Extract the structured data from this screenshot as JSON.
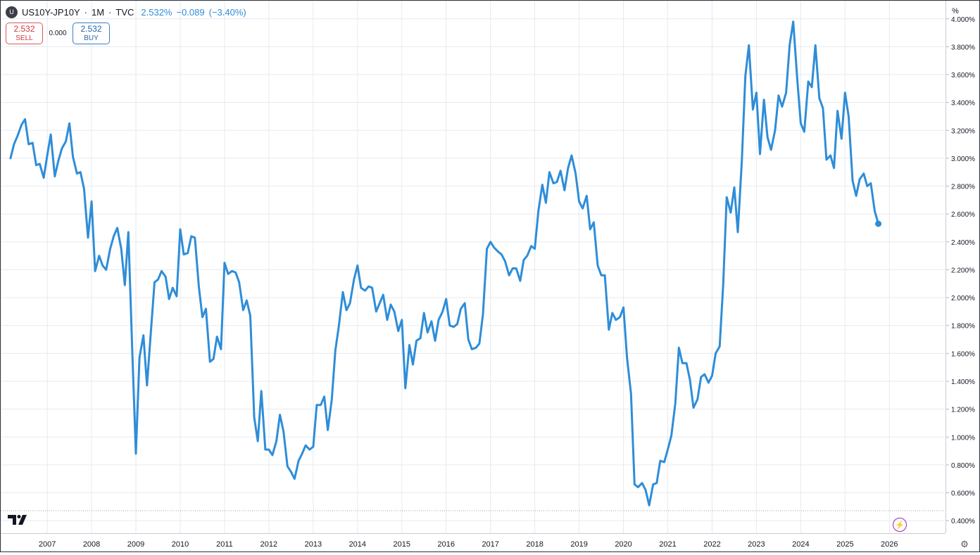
{
  "header": {
    "symbol_icon": "U",
    "symbol": "US10Y-JP10Y",
    "interval": "1M",
    "source": "TVC",
    "sep": "·",
    "last": "2.532%",
    "change": "−0.089",
    "change_pct": "(−3.40%)"
  },
  "trade": {
    "sell_price": "2.532",
    "sell_label": "SELL",
    "spread": "0.000",
    "buy_price": "2.532",
    "buy_label": "BUY"
  },
  "price_axis": {
    "unit": "%"
  },
  "icons": {
    "logo": "tradingview-logo",
    "bolt": "lightning-icon",
    "settings": "gear-icon"
  },
  "colors": {
    "line": "#2e8dd8",
    "grid": "#e6eaf0",
    "sell": "#d0393d",
    "buy": "#2962a8",
    "accent": "#9c27b0"
  },
  "chart_data": {
    "type": "line",
    "title": "",
    "xlabel": "",
    "ylabel": "",
    "xlim": [
      2005.95,
      2027.25
    ],
    "ylim": [
      0.31,
      4.13
    ],
    "grid": true,
    "x_ticks": [
      "2007",
      "2008",
      "2009",
      "2010",
      "2011",
      "2012",
      "2013",
      "2014",
      "2015",
      "2016",
      "2017",
      "2018",
      "2019",
      "2020",
      "2021",
      "2022",
      "2023",
      "2024",
      "2025",
      "2026"
    ],
    "y_ticks": [
      "0.400%",
      "0.600%",
      "0.800%",
      "1.000%",
      "1.200%",
      "1.400%",
      "1.600%",
      "1.800%",
      "2.000%",
      "2.200%",
      "2.400%",
      "2.600%",
      "2.800%",
      "3.000%",
      "3.200%",
      "3.400%",
      "3.600%",
      "3.800%",
      "4.000%"
    ],
    "series": [
      {
        "values": [
          [
            2006.17,
            3.0
          ],
          [
            2006.25,
            3.1
          ],
          [
            2006.33,
            3.16
          ],
          [
            2006.42,
            3.24
          ],
          [
            2006.5,
            3.28
          ],
          [
            2006.58,
            3.1
          ],
          [
            2006.67,
            3.11
          ],
          [
            2006.75,
            2.95
          ],
          [
            2006.83,
            2.96
          ],
          [
            2006.92,
            2.86
          ],
          [
            2007.0,
            3.02
          ],
          [
            2007.08,
            3.17
          ],
          [
            2007.17,
            2.87
          ],
          [
            2007.25,
            2.98
          ],
          [
            2007.33,
            3.07
          ],
          [
            2007.42,
            3.12
          ],
          [
            2007.5,
            3.25
          ],
          [
            2007.58,
            3.01
          ],
          [
            2007.67,
            2.89
          ],
          [
            2007.75,
            2.9
          ],
          [
            2007.83,
            2.78
          ],
          [
            2007.92,
            2.43
          ],
          [
            2008.0,
            2.69
          ],
          [
            2008.08,
            2.19
          ],
          [
            2008.17,
            2.3
          ],
          [
            2008.25,
            2.23
          ],
          [
            2008.33,
            2.2
          ],
          [
            2008.42,
            2.35
          ],
          [
            2008.5,
            2.44
          ],
          [
            2008.58,
            2.5
          ],
          [
            2008.67,
            2.35
          ],
          [
            2008.75,
            2.09
          ],
          [
            2008.83,
            2.47
          ],
          [
            2008.92,
            1.6
          ],
          [
            2009.0,
            0.88
          ],
          [
            2009.08,
            1.57
          ],
          [
            2009.17,
            1.73
          ],
          [
            2009.25,
            1.37
          ],
          [
            2009.33,
            1.72
          ],
          [
            2009.42,
            2.11
          ],
          [
            2009.5,
            2.13
          ],
          [
            2009.58,
            2.19
          ],
          [
            2009.67,
            2.15
          ],
          [
            2009.75,
            1.99
          ],
          [
            2009.83,
            2.07
          ],
          [
            2009.92,
            2.01
          ],
          [
            2010.0,
            2.49
          ],
          [
            2010.08,
            2.31
          ],
          [
            2010.17,
            2.32
          ],
          [
            2010.25,
            2.44
          ],
          [
            2010.33,
            2.43
          ],
          [
            2010.42,
            2.08
          ],
          [
            2010.5,
            1.86
          ],
          [
            2010.58,
            1.92
          ],
          [
            2010.67,
            1.54
          ],
          [
            2010.75,
            1.56
          ],
          [
            2010.83,
            1.72
          ],
          [
            2010.92,
            1.63
          ],
          [
            2011.0,
            2.25
          ],
          [
            2011.08,
            2.17
          ],
          [
            2011.17,
            2.19
          ],
          [
            2011.25,
            2.18
          ],
          [
            2011.33,
            2.11
          ],
          [
            2011.42,
            1.91
          ],
          [
            2011.5,
            1.98
          ],
          [
            2011.58,
            1.87
          ],
          [
            2011.67,
            1.14
          ],
          [
            2011.75,
            0.97
          ],
          [
            2011.83,
            1.33
          ],
          [
            2011.92,
            0.91
          ],
          [
            2012.0,
            0.91
          ],
          [
            2012.08,
            0.87
          ],
          [
            2012.17,
            0.97
          ],
          [
            2012.25,
            1.16
          ],
          [
            2012.33,
            1.04
          ],
          [
            2012.42,
            0.79
          ],
          [
            2012.5,
            0.75
          ],
          [
            2012.58,
            0.7
          ],
          [
            2012.67,
            0.83
          ],
          [
            2012.75,
            0.88
          ],
          [
            2012.83,
            0.94
          ],
          [
            2012.92,
            0.91
          ],
          [
            2013.0,
            0.93
          ],
          [
            2013.08,
            1.23
          ],
          [
            2013.17,
            1.23
          ],
          [
            2013.25,
            1.29
          ],
          [
            2013.33,
            1.05
          ],
          [
            2013.42,
            1.27
          ],
          [
            2013.5,
            1.62
          ],
          [
            2013.58,
            1.8
          ],
          [
            2013.67,
            2.04
          ],
          [
            2013.75,
            1.91
          ],
          [
            2013.83,
            1.96
          ],
          [
            2013.92,
            2.13
          ],
          [
            2014.0,
            2.23
          ],
          [
            2014.08,
            2.07
          ],
          [
            2014.17,
            2.05
          ],
          [
            2014.25,
            2.08
          ],
          [
            2014.33,
            2.07
          ],
          [
            2014.42,
            1.9
          ],
          [
            2014.5,
            1.96
          ],
          [
            2014.58,
            2.02
          ],
          [
            2014.67,
            1.84
          ],
          [
            2014.75,
            1.95
          ],
          [
            2014.83,
            1.9
          ],
          [
            2014.92,
            1.76
          ],
          [
            2015.0,
            1.84
          ],
          [
            2015.08,
            1.35
          ],
          [
            2015.17,
            1.66
          ],
          [
            2015.25,
            1.52
          ],
          [
            2015.33,
            1.69
          ],
          [
            2015.42,
            1.71
          ],
          [
            2015.5,
            1.89
          ],
          [
            2015.58,
            1.75
          ],
          [
            2015.67,
            1.83
          ],
          [
            2015.75,
            1.69
          ],
          [
            2015.83,
            1.84
          ],
          [
            2015.92,
            1.9
          ],
          [
            2016.0,
            1.99
          ],
          [
            2016.08,
            1.8
          ],
          [
            2016.17,
            1.79
          ],
          [
            2016.25,
            1.81
          ],
          [
            2016.33,
            1.92
          ],
          [
            2016.42,
            1.96
          ],
          [
            2016.5,
            1.7
          ],
          [
            2016.58,
            1.63
          ],
          [
            2016.67,
            1.64
          ],
          [
            2016.75,
            1.67
          ],
          [
            2016.83,
            1.88
          ],
          [
            2016.92,
            2.35
          ],
          [
            2017.0,
            2.4
          ],
          [
            2017.08,
            2.36
          ],
          [
            2017.17,
            2.33
          ],
          [
            2017.25,
            2.31
          ],
          [
            2017.33,
            2.26
          ],
          [
            2017.42,
            2.16
          ],
          [
            2017.5,
            2.21
          ],
          [
            2017.58,
            2.21
          ],
          [
            2017.67,
            2.12
          ],
          [
            2017.75,
            2.27
          ],
          [
            2017.83,
            2.3
          ],
          [
            2017.92,
            2.37
          ],
          [
            2018.0,
            2.35
          ],
          [
            2018.08,
            2.62
          ],
          [
            2018.17,
            2.81
          ],
          [
            2018.25,
            2.68
          ],
          [
            2018.33,
            2.9
          ],
          [
            2018.42,
            2.82
          ],
          [
            2018.5,
            2.83
          ],
          [
            2018.58,
            2.91
          ],
          [
            2018.67,
            2.77
          ],
          [
            2018.75,
            2.93
          ],
          [
            2018.83,
            3.02
          ],
          [
            2018.92,
            2.89
          ],
          [
            2019.0,
            2.69
          ],
          [
            2019.08,
            2.64
          ],
          [
            2019.17,
            2.73
          ],
          [
            2019.25,
            2.49
          ],
          [
            2019.33,
            2.54
          ],
          [
            2019.42,
            2.23
          ],
          [
            2019.5,
            2.16
          ],
          [
            2019.58,
            2.16
          ],
          [
            2019.67,
            1.77
          ],
          [
            2019.75,
            1.89
          ],
          [
            2019.83,
            1.84
          ],
          [
            2019.92,
            1.86
          ],
          [
            2020.0,
            1.93
          ],
          [
            2020.08,
            1.57
          ],
          [
            2020.17,
            1.31
          ],
          [
            2020.25,
            0.66
          ],
          [
            2020.33,
            0.64
          ],
          [
            2020.42,
            0.67
          ],
          [
            2020.5,
            0.62
          ],
          [
            2020.58,
            0.51
          ],
          [
            2020.67,
            0.66
          ],
          [
            2020.75,
            0.67
          ],
          [
            2020.83,
            0.83
          ],
          [
            2020.92,
            0.82
          ],
          [
            2021.0,
            0.91
          ],
          [
            2021.08,
            1.01
          ],
          [
            2021.17,
            1.24
          ],
          [
            2021.25,
            1.64
          ],
          [
            2021.33,
            1.53
          ],
          [
            2021.42,
            1.53
          ],
          [
            2021.5,
            1.41
          ],
          [
            2021.58,
            1.21
          ],
          [
            2021.67,
            1.27
          ],
          [
            2021.75,
            1.43
          ],
          [
            2021.83,
            1.45
          ],
          [
            2021.92,
            1.39
          ],
          [
            2022.0,
            1.44
          ],
          [
            2022.08,
            1.6
          ],
          [
            2022.17,
            1.65
          ],
          [
            2022.25,
            2.09
          ],
          [
            2022.33,
            2.72
          ],
          [
            2022.42,
            2.61
          ],
          [
            2022.5,
            2.79
          ],
          [
            2022.58,
            2.47
          ],
          [
            2022.67,
            2.98
          ],
          [
            2022.75,
            3.59
          ],
          [
            2022.83,
            3.81
          ],
          [
            2022.92,
            3.35
          ],
          [
            2023.0,
            3.47
          ],
          [
            2023.08,
            3.03
          ],
          [
            2023.17,
            3.42
          ],
          [
            2023.25,
            3.15
          ],
          [
            2023.33,
            3.06
          ],
          [
            2023.42,
            3.2
          ],
          [
            2023.5,
            3.45
          ],
          [
            2023.58,
            3.37
          ],
          [
            2023.67,
            3.47
          ],
          [
            2023.75,
            3.81
          ],
          [
            2023.83,
            3.98
          ],
          [
            2023.92,
            3.57
          ],
          [
            2024.0,
            3.25
          ],
          [
            2024.08,
            3.19
          ],
          [
            2024.17,
            3.55
          ],
          [
            2024.25,
            3.51
          ],
          [
            2024.33,
            3.81
          ],
          [
            2024.42,
            3.43
          ],
          [
            2024.5,
            3.36
          ],
          [
            2024.58,
            2.99
          ],
          [
            2024.67,
            3.02
          ],
          [
            2024.75,
            2.93
          ],
          [
            2024.83,
            3.34
          ],
          [
            2024.92,
            3.14
          ],
          [
            2025.0,
            3.47
          ],
          [
            2025.08,
            3.3
          ],
          [
            2025.17,
            2.84
          ],
          [
            2025.25,
            2.73
          ],
          [
            2025.33,
            2.85
          ],
          [
            2025.42,
            2.89
          ],
          [
            2025.5,
            2.8
          ],
          [
            2025.58,
            2.82
          ],
          [
            2025.67,
            2.62
          ],
          [
            2025.75,
            2.53
          ]
        ]
      }
    ]
  }
}
